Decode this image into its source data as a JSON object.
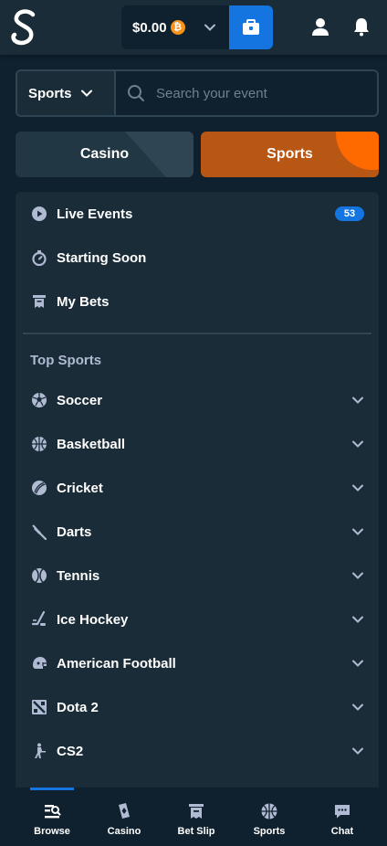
{
  "header": {
    "balance": "$0.00",
    "currency_symbol": "₿"
  },
  "search": {
    "sport_select": "Sports",
    "placeholder": "Search your event"
  },
  "toggle": {
    "casino": "Casino",
    "sports": "Sports",
    "active": "Sports"
  },
  "menu": {
    "live_events": "Live Events",
    "live_count": "53",
    "starting_soon": "Starting Soon",
    "my_bets": "My Bets"
  },
  "top_sports": {
    "title": "Top Sports",
    "items": [
      {
        "label": "Soccer",
        "icon": "soccer-icon"
      },
      {
        "label": "Basketball",
        "icon": "basketball-icon"
      },
      {
        "label": "Cricket",
        "icon": "cricket-icon"
      },
      {
        "label": "Darts",
        "icon": "darts-icon"
      },
      {
        "label": "Tennis",
        "icon": "tennis-icon"
      },
      {
        "label": "Ice Hockey",
        "icon": "ice-hockey-icon"
      },
      {
        "label": "American Football",
        "icon": "american-football-icon"
      },
      {
        "label": "Dota 2",
        "icon": "dota-2-icon"
      },
      {
        "label": "CS2",
        "icon": "cs2-icon"
      }
    ]
  },
  "bottom_nav": {
    "active": "Browse",
    "items": [
      {
        "label": "Browse",
        "icon": "browse-icon"
      },
      {
        "label": "Casino",
        "icon": "casino-icon"
      },
      {
        "label": "Bet Slip",
        "icon": "bet-slip-icon"
      },
      {
        "label": "Sports",
        "icon": "sports-icon"
      },
      {
        "label": "Chat",
        "icon": "chat-icon"
      }
    ]
  },
  "colors": {
    "background": "#0f212e",
    "panel": "#1a2c38",
    "accent_blue": "#1475e1",
    "sports_orange": "#b85614",
    "muted_text": "#b1bad3",
    "icon_gray": "#b1bad3"
  }
}
